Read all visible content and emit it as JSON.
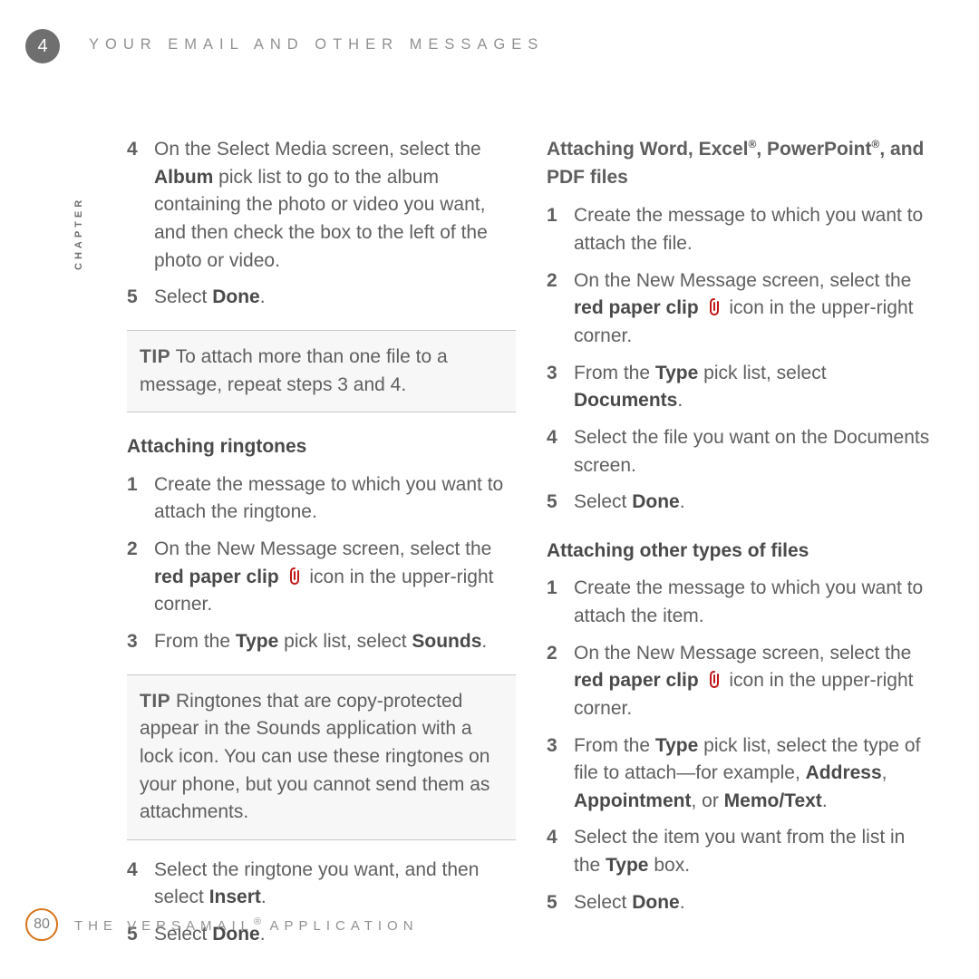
{
  "chapter": {
    "number": "4",
    "label": "CHAPTER"
  },
  "header": "YOUR EMAIL AND OTHER MESSAGES",
  "footer": {
    "page": "80",
    "app": "THE VERSAMAIL",
    "app_suffix": " APPLICATION"
  },
  "left": {
    "cont": {
      "n4": "4",
      "t4a": "On the Select Media screen, select the ",
      "t4b": "Album",
      "t4c": " pick list to go to the album containing the photo or video you want, and then check the box to the left of the photo or video.",
      "n5": "5",
      "t5a": "Select ",
      "t5b": "Done",
      "t5c": "."
    },
    "tip1": {
      "label": "TIP",
      "text": " To attach more than one file to a message, repeat steps 3 and 4."
    },
    "ring": {
      "head": "Attaching ringtones",
      "n1": "1",
      "t1": "Create the message to which you want to attach the ringtone.",
      "n2": "2",
      "t2a": "On the New Message screen, select the ",
      "t2b": "red paper clip ",
      "t2c": " icon in the upper-right corner.",
      "n3": "3",
      "t3a": "From the ",
      "t3b": "Type",
      "t3c": " pick list, select ",
      "t3d": "Sounds",
      "t3e": "."
    },
    "tip2": {
      "label": "TIP",
      "text": " Ringtones that are copy-protected appear in the Sounds application with a lock icon. You can use these ringtones on your phone, but you cannot send them as attachments."
    },
    "ring2": {
      "n4": "4",
      "t4a": "Select the ringtone you want, and then select ",
      "t4b": "Insert",
      "t4c": ".",
      "n5": "5",
      "t5a": "Select ",
      "t5b": "Done",
      "t5c": "."
    }
  },
  "right": {
    "docs": {
      "head_a": "Attaching Word, Excel",
      "head_b": ", PowerPoint",
      "head_c": ", and PDF files",
      "n1": "1",
      "t1": "Create the message to which you want to attach the file.",
      "n2": "2",
      "t2a": "On the New Message screen, select the ",
      "t2b": "red paper clip ",
      "t2c": " icon in the upper-right corner.",
      "n3": "3",
      "t3a": "From the ",
      "t3b": "Type",
      "t3c": " pick list, select ",
      "t3d": "Documents",
      "t3e": ".",
      "n4": "4",
      "t4": "Select the file you want on the Documents screen.",
      "n5": "5",
      "t5a": "Select ",
      "t5b": "Done",
      "t5c": "."
    },
    "other": {
      "head": "Attaching other types of files",
      "n1": "1",
      "t1": "Create the message to which you want to attach the item.",
      "n2": "2",
      "t2a": "On the New Message screen, select the ",
      "t2b": "red paper clip ",
      "t2c": " icon in the upper-right corner.",
      "n3": "3",
      "t3a": "From the ",
      "t3b": "Type",
      "t3c": " pick list, select the type of file to attach—for example, ",
      "t3d": "Address",
      "t3e": ", ",
      "t3f": "Appointment",
      "t3g": ", or ",
      "t3h": "Memo/Text",
      "t3i": ".",
      "n4": "4",
      "t4a": "Select the item you want from the list in the ",
      "t4b": "Type",
      "t4c": " box.",
      "n5": "5",
      "t5a": "Select ",
      "t5b": "Done",
      "t5c": "."
    }
  }
}
